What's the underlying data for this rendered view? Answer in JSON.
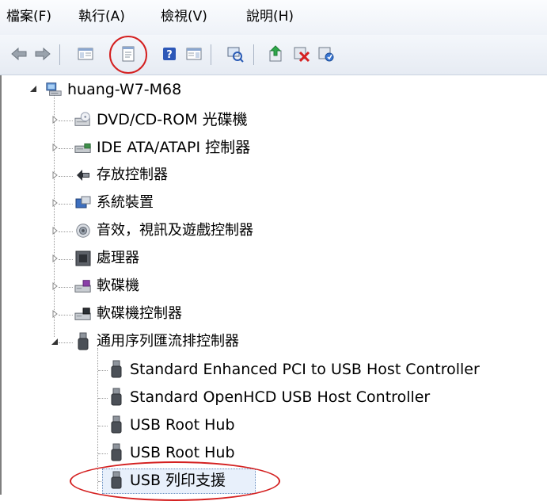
{
  "menu": {
    "file": "檔案(F)",
    "action": "執行(A)",
    "view": "檢視(V)",
    "help": "說明(H)"
  },
  "toolbar": {
    "icons": [
      "back-arrow-icon",
      "forward-arrow-icon",
      "show-hide-tree-icon",
      "properties-icon",
      "help-icon",
      "console-view-icon",
      "scan-hardware-icon",
      "update-driver-icon",
      "uninstall-icon",
      "enable-device-icon"
    ]
  },
  "tree": {
    "root": "huang-W7-M68",
    "categories": [
      "DVD/CD-ROM 光碟機",
      "IDE ATA/ATAPI 控制器",
      "存放控制器",
      "系統裝置",
      "音效，視訊及遊戲控制器",
      "處理器",
      "軟碟機",
      "軟碟機控制器",
      "通用序列匯流排控制器"
    ],
    "usb_children": [
      "Standard Enhanced PCI to USB Host Controller",
      "Standard OpenHCD USB Host Controller",
      "USB Root Hub",
      "USB Root Hub",
      "USB 列印支援"
    ]
  }
}
